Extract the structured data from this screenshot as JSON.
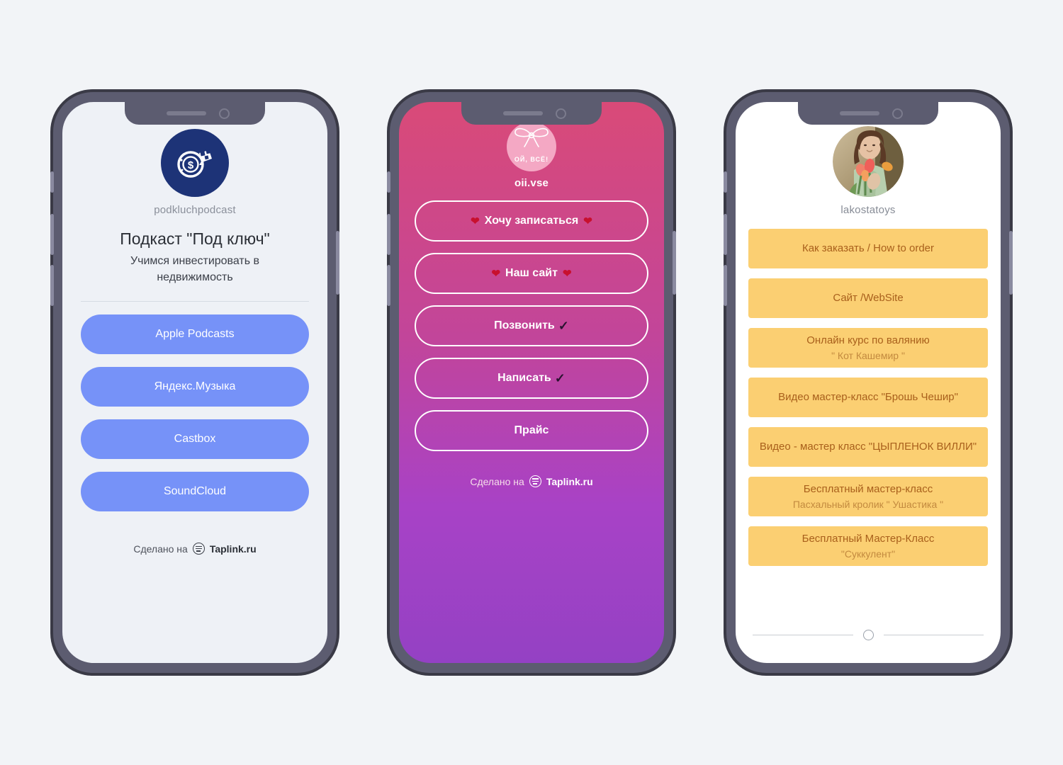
{
  "phones": [
    {
      "id": "podcast",
      "avatar_icon": "money-bag-coin-icon",
      "handle": "podkluchpodcast",
      "title": "Подкаст \"Под ключ\"",
      "subtitle": "Учимся инвестировать в недвижимость",
      "accent_color": "#7692f8",
      "background_color": "#eef1f6",
      "buttons": [
        {
          "label": "Apple Podcasts"
        },
        {
          "label": "Яндекс.Музыка"
        },
        {
          "label": "Castbox"
        },
        {
          "label": "SoundCloud"
        }
      ],
      "footer": {
        "made_on": "Сделано на",
        "brand": "Taplink.ru",
        "icon": "taplink-logo-icon"
      }
    },
    {
      "id": "oiivse",
      "avatar_icon": "pink-bow-icon",
      "avatar_text": "ОЙ, ВСЁ!",
      "handle": "oii.vse",
      "gradient_from": "#d94a78",
      "gradient_to": "#9441c4",
      "buttons": [
        {
          "label": "Хочу записаться",
          "left_icon": "heart-icon",
          "right_icon": "heart-icon"
        },
        {
          "label": "Наш сайт",
          "left_icon": "heart-icon",
          "right_icon": "heart-icon"
        },
        {
          "label": "Позвонить",
          "right_icon": "check-icon"
        },
        {
          "label": "Написать",
          "right_icon": "check-icon"
        },
        {
          "label": "Прайс"
        }
      ],
      "footer": {
        "made_on": "Сделано на",
        "brand": "Taplink.ru",
        "icon": "taplink-logo-icon"
      }
    },
    {
      "id": "lakostatoys",
      "avatar_icon": "woman-with-tulips-photo",
      "handle": "lakostatoys",
      "accent_color": "#fbcf72",
      "text_color": "#a9601c",
      "buttons": [
        {
          "line1": "Как заказать / How to order",
          "line2": ""
        },
        {
          "line1": "Сайт /WebSite",
          "line2": ""
        },
        {
          "line1": "Онлайн курс по валянию",
          "line2": "\" Кот Кашемир \""
        },
        {
          "line1": "Видео мастер-класс \"Брошь Чешир\"",
          "line2": ""
        },
        {
          "line1": "Видео - мастер класс \"ЦЫПЛЕНОК ВИЛЛИ\"",
          "line2": ""
        },
        {
          "line1": "Бесплатный мастер-класс",
          "line2": "Пасхальный кролик \" Ушастика \""
        },
        {
          "line1": "Бесплатный Мастер-Класс",
          "line2": "\"Суккулент\""
        }
      ]
    }
  ]
}
